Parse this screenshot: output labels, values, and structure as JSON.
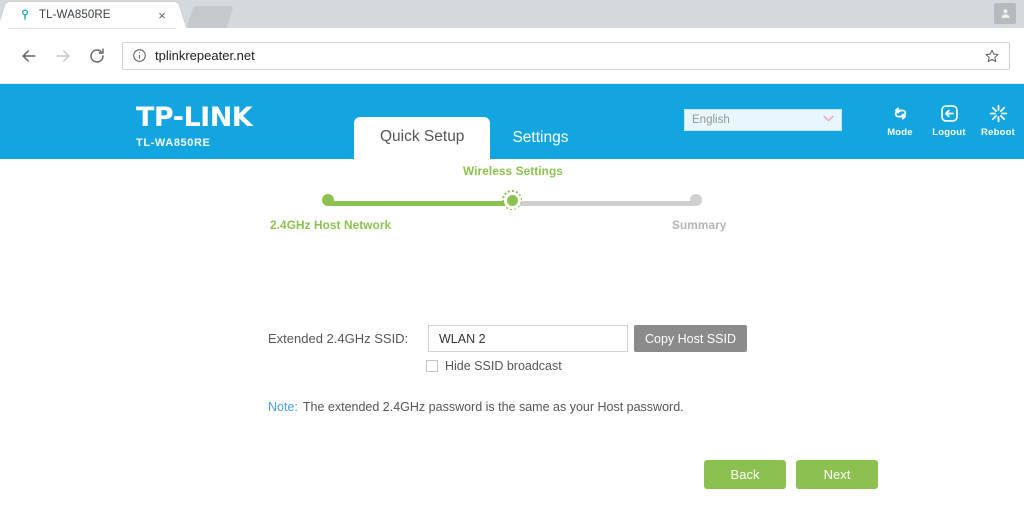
{
  "browser": {
    "tab": {
      "title": "TL-WA850RE",
      "favicon": "tplink-favicon",
      "close": "×"
    },
    "new_tab_label": "",
    "profile_icon": "user-avatar-icon",
    "toolbar": {
      "back_icon": "arrow-left-icon",
      "forward_icon": "arrow-right-icon",
      "reload_icon": "reload-icon",
      "security_icon": "info-circle-icon",
      "url": "tplinkrepeater.net",
      "bookmark_icon": "star-outline-icon"
    }
  },
  "header": {
    "logo": "TP-LINK",
    "model": "TL-WA850RE",
    "tabs": [
      {
        "label": "Quick Setup",
        "active": true
      },
      {
        "label": "Settings",
        "active": false
      }
    ],
    "language": {
      "selected": "English",
      "chevron": "▼",
      "options": [
        "English"
      ]
    },
    "actions": [
      {
        "label": "Mode",
        "icon": "mode-cycle-icon"
      },
      {
        "label": "Logout",
        "icon": "logout-icon"
      },
      {
        "label": "Reboot",
        "icon": "reboot-burst-icon"
      }
    ],
    "colors": {
      "brand_blue": "#13a5e0",
      "accent_green": "#8cc152",
      "note_blue": "#4aa3d8",
      "gray_button": "#8b8b8b"
    }
  },
  "stepper": {
    "steps": [
      {
        "label": "2.4GHz Host Network",
        "state": "complete",
        "position": "below"
      },
      {
        "label": "Wireless Settings",
        "state": "current",
        "position": "above"
      },
      {
        "label": "Summary",
        "state": "inactive",
        "position": "below"
      }
    ],
    "progress_percent": 50
  },
  "form": {
    "ssid_label": "Extended 2.4GHz SSID:",
    "ssid_value": "WLAN 2",
    "ssid_placeholder": "",
    "copy_button": "Copy Host SSID",
    "hide_ssid_label": "Hide SSID broadcast",
    "hide_ssid_checked": false,
    "note_key": "Note:",
    "note_text": "The extended 2.4GHz password is the same as your Host password.",
    "back_button": "Back",
    "next_button": "Next"
  }
}
